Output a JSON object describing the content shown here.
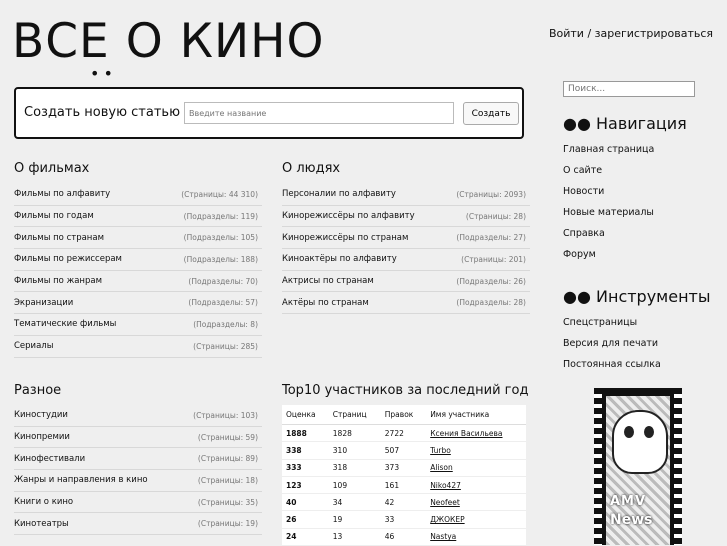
{
  "header": {
    "logo_text": "ВСЕ О КИНО",
    "logo_dots": "••",
    "auth_link": "Войти / зарегистрироваться"
  },
  "create": {
    "label": "Создать новую статью",
    "input_placeholder": "Введите название",
    "button_label": "Создать"
  },
  "films": {
    "title": "О фильмах",
    "items": [
      {
        "name": "Фильмы по алфавиту",
        "count": "(Страницы: 44 310)"
      },
      {
        "name": "Фильмы по годам",
        "count": "(Подразделы: 119)"
      },
      {
        "name": "Фильмы по странам",
        "count": "(Подразделы: 105)"
      },
      {
        "name": "Фильмы по режиссерам",
        "count": "(Подразделы: 188)"
      },
      {
        "name": "Фильмы по жанрам",
        "count": "(Подразделы: 70)"
      },
      {
        "name": "Экранизации",
        "count": "(Подразделы: 57)"
      },
      {
        "name": "Тематические фильмы",
        "count": "(Подразделы: 8)"
      },
      {
        "name": "Сериалы",
        "count": "(Страницы: 285)"
      }
    ]
  },
  "people": {
    "title": "О людях",
    "items": [
      {
        "name": "Персоналии по алфавиту",
        "count": "(Страницы: 2093)"
      },
      {
        "name": "Кинорежиссёры по алфавиту",
        "count": "(Страницы: 28)"
      },
      {
        "name": "Кинорежиссёры по странам",
        "count": "(Подразделы: 27)"
      },
      {
        "name": "Киноактёры по алфавиту",
        "count": "(Страницы: 201)"
      },
      {
        "name": "Актрисы по странам",
        "count": "(Подразделы: 26)"
      },
      {
        "name": "Актёры по странам",
        "count": "(Подразделы: 28)"
      }
    ]
  },
  "misc": {
    "title": "Разное",
    "items": [
      {
        "name": "Киностудии",
        "count": "(Страницы: 103)"
      },
      {
        "name": "Кинопремии",
        "count": "(Страницы: 59)"
      },
      {
        "name": "Кинофестивали",
        "count": "(Страницы: 89)"
      },
      {
        "name": "Жанры и направления в кино",
        "count": "(Страницы: 18)"
      },
      {
        "name": "Книги о кино",
        "count": "(Страницы: 35)"
      },
      {
        "name": "Кинотеатры",
        "count": "(Страницы: 19)"
      }
    ]
  },
  "top10": {
    "title": "Top10 участников за последний год",
    "headers": [
      "Оценка",
      "Страниц",
      "Правок",
      "Имя участника"
    ],
    "rows": [
      [
        "1888",
        "1828",
        "2722",
        "Ксения Васильева"
      ],
      [
        "338",
        "310",
        "507",
        "Turbo"
      ],
      [
        "333",
        "318",
        "373",
        "Alison"
      ],
      [
        "123",
        "109",
        "161",
        "Niko427"
      ],
      [
        "40",
        "34",
        "42",
        "Neofeet"
      ],
      [
        "26",
        "19",
        "33",
        "ДЖОКЕР"
      ],
      [
        "24",
        "13",
        "46",
        "Nastya"
      ]
    ]
  },
  "sidebar": {
    "search_placeholder": "Поиск...",
    "nav_title": "●● Навигация",
    "nav_items": [
      "Главная страница",
      "О сайте",
      "Новости",
      "Новые материалы",
      "Справка",
      "Форум"
    ],
    "tools_title": "●● Инструменты",
    "tools_items": [
      "Спецстраницы",
      "Версия для печати",
      "Постоянная ссылка"
    ]
  },
  "banner": {
    "line1": "AMV",
    "line2": "News"
  }
}
